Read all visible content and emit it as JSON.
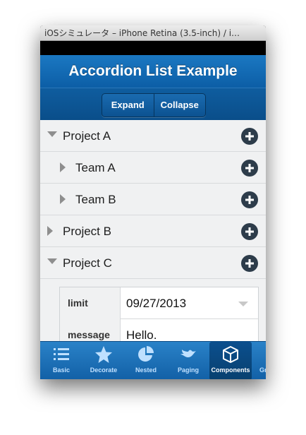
{
  "window": {
    "title": "iOSシミュレータ – iPhone Retina (3.5-inch) / i…"
  },
  "navbar": {
    "title": "Accordion List Example"
  },
  "toolbar": {
    "expand_label": "Expand",
    "collapse_label": "Collapse"
  },
  "list": {
    "items": [
      {
        "label": "Project A",
        "state": "expanded"
      },
      {
        "label": "Team A",
        "state": "collapsed"
      },
      {
        "label": "Team B",
        "state": "collapsed"
      },
      {
        "label": "Project B",
        "state": "collapsed"
      },
      {
        "label": "Project C",
        "state": "expanded"
      }
    ]
  },
  "form": {
    "limit": {
      "label": "limit",
      "value": "09/27/2013"
    },
    "message": {
      "label": "message",
      "value": "Hello."
    }
  },
  "tabbar": {
    "tabs": [
      {
        "label": "Basic",
        "icon": "list-icon"
      },
      {
        "label": "Decorate",
        "icon": "star-icon"
      },
      {
        "label": "Nested",
        "icon": "pie-chart-icon"
      },
      {
        "label": "Paging",
        "icon": "bird-icon"
      },
      {
        "label": "Components",
        "icon": "box-icon",
        "active": true
      },
      {
        "label": "Gr",
        "icon": "partial-icon"
      }
    ]
  },
  "colors": {
    "accent": "#1b78c2",
    "plus_button": "#2d3c4a",
    "list_bg": "#f0f1f2"
  }
}
